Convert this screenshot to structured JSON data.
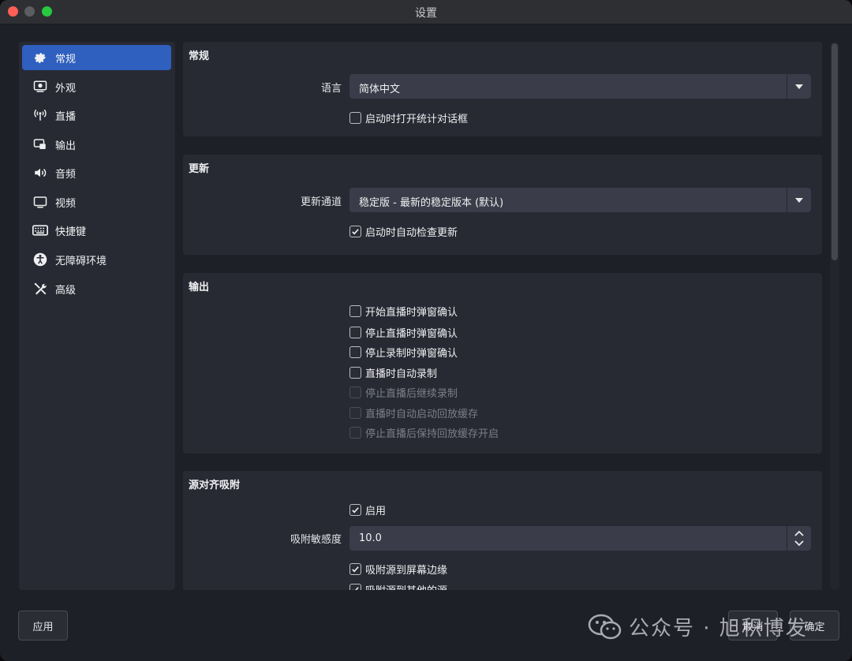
{
  "window": {
    "title": "设置"
  },
  "sidebar": {
    "items": [
      {
        "label": "常规",
        "icon": "gear-icon",
        "active": true
      },
      {
        "label": "外观",
        "icon": "appearance-icon"
      },
      {
        "label": "直播",
        "icon": "broadcast-antenna-icon"
      },
      {
        "label": "输出",
        "icon": "output-icon"
      },
      {
        "label": "音频",
        "icon": "speaker-icon"
      },
      {
        "label": "视频",
        "icon": "monitor-icon"
      },
      {
        "label": "快捷键",
        "icon": "keyboard-icon"
      },
      {
        "label": "无障碍环境",
        "icon": "accessibility-icon"
      },
      {
        "label": "高级",
        "icon": "tools-icon"
      }
    ]
  },
  "general": {
    "title": "常规",
    "language_label": "语言",
    "language_value": "简体中文",
    "open_stats_label": "启动时打开统计对话框",
    "open_stats_checked": false
  },
  "update": {
    "title": "更新",
    "channel_label": "更新通道",
    "channel_value": "稳定版 - 最新的稳定版本 (默认)",
    "auto_check_label": "启动时自动检查更新",
    "auto_check_checked": true
  },
  "output": {
    "title": "输出",
    "options": [
      {
        "label": "开始直播时弹窗确认",
        "checked": false,
        "disabled": false
      },
      {
        "label": "停止直播时弹窗确认",
        "checked": false,
        "disabled": false
      },
      {
        "label": "停止录制时弹窗确认",
        "checked": false,
        "disabled": false
      },
      {
        "label": "直播时自动录制",
        "checked": false,
        "disabled": false
      },
      {
        "label": "停止直播后继续录制",
        "checked": false,
        "disabled": true
      },
      {
        "label": "直播时自动启动回放缓存",
        "checked": false,
        "disabled": true
      },
      {
        "label": "停止直播后保持回放缓存开启",
        "checked": false,
        "disabled": true
      }
    ]
  },
  "snapping": {
    "title": "源对齐吸附",
    "enable_label": "启用",
    "enable_checked": true,
    "sensitivity_label": "吸附敏感度",
    "sensitivity_value": "10.0",
    "screen_edge_label": "吸附源到屏幕边缘",
    "screen_edge_checked": true,
    "other_sources_label": "吸附源到其他的源",
    "other_sources_checked": true
  },
  "footer": {
    "apply_label": "应用",
    "cancel_label": "取消",
    "ok_label": "确定"
  },
  "watermark": {
    "text": "公众号 · 旭积博发"
  }
}
